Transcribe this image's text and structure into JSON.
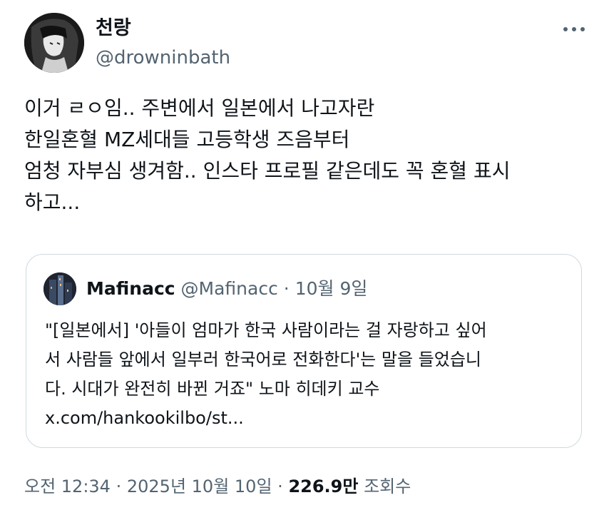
{
  "author": {
    "display_name": "천랑",
    "handle": "@drowninbath"
  },
  "more_icon": "more-horizontal-icon",
  "tweet_lines": [
    "이거 ㄹㅇ임.. 주변에서 일본에서 나고자란",
    "한일혼혈 MZ세대들 고등학생 즈음부터",
    "엄청 자부심 생겨함.. 인스타 프로필 같은데도 꼭 혼혈 표시",
    "하고..."
  ],
  "quoted_tweet": {
    "display_name": "Mafinacc",
    "handle": "@Mafinacc",
    "separator": "·",
    "date": "10월 9일",
    "lines": [
      "\"[일본에서] '아들이 엄마가 한국 사람이라는 걸 자랑하고 싶어",
      "서 사람들 앞에서 일부러 한국어로 전화한다'는 말을 들었습니",
      "다. 시대가 완전히 바뀐 거죠\" 노마 히데키 교수",
      "x.com/hankookilbo/st..."
    ]
  },
  "footer": {
    "time": "오전 12:34",
    "separator": "·",
    "date": "2025년 10월 10일",
    "views_count": "226.9만",
    "views_label": "조회수"
  },
  "colors": {
    "text": "#0f1419",
    "secondary": "#536471",
    "border": "#cfd9de"
  }
}
